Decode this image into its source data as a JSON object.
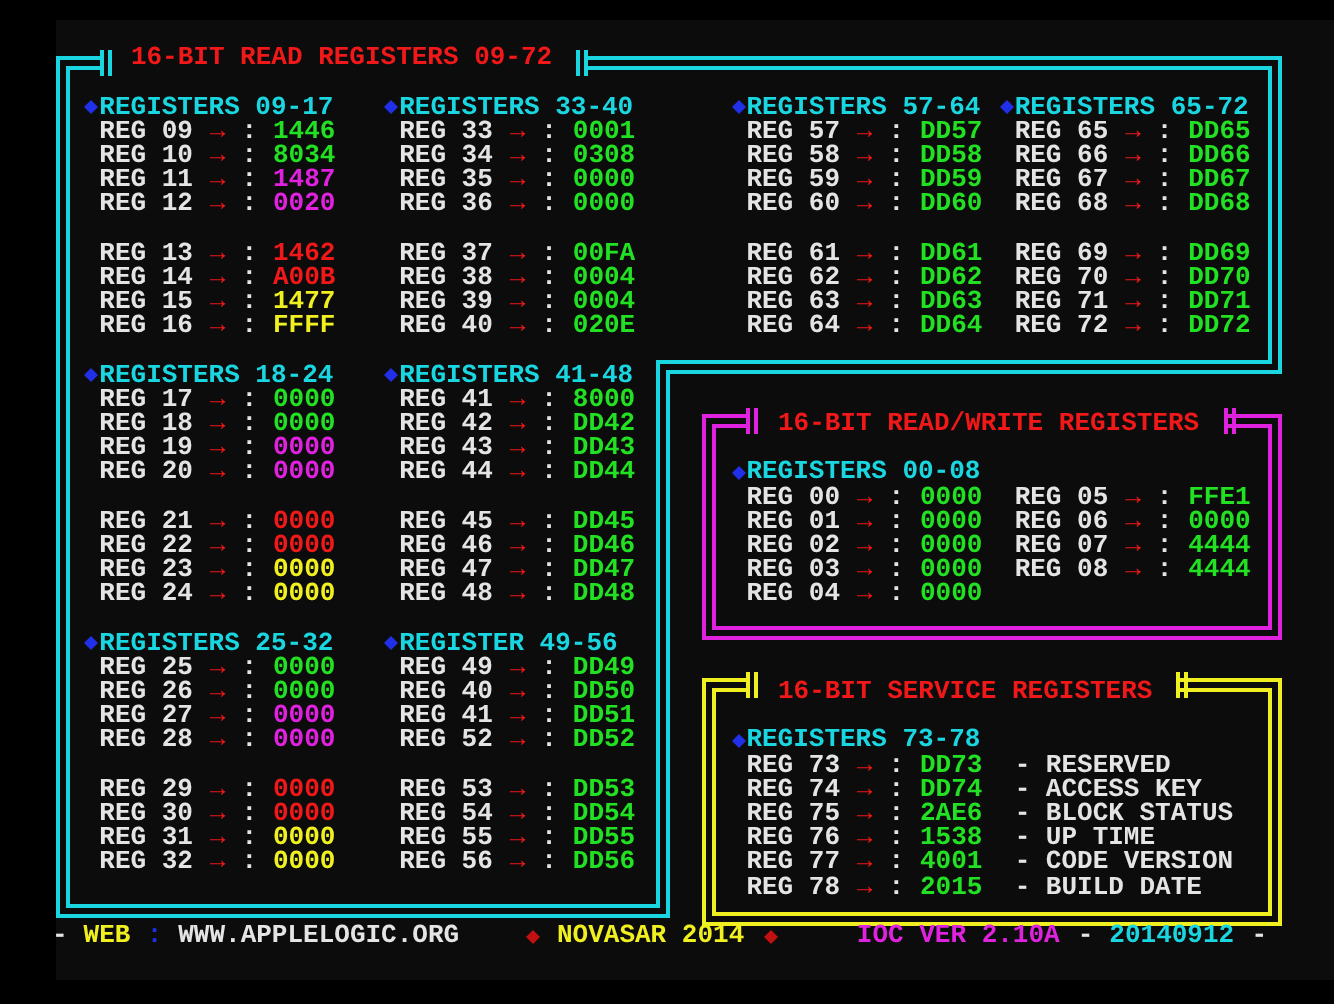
{
  "read_panel": {
    "title": "16-BIT READ REGISTERS 09-72",
    "groups": [
      {
        "heading": "REGISTERS 09-17",
        "registers": [
          {
            "label": "REG 09",
            "arrow": "→",
            "sep": ":",
            "value": "1446",
            "color": "#22e022"
          },
          {
            "label": "REG 10",
            "arrow": "→",
            "sep": ":",
            "value": "8034",
            "color": "#22e022"
          },
          {
            "label": "REG 11",
            "arrow": "→",
            "sep": ":",
            "value": "1487",
            "color": "#e022e0"
          },
          {
            "label": "REG 12",
            "arrow": "→",
            "sep": ":",
            "value": "0020",
            "color": "#e022e0"
          },
          {
            "label": "REG 13",
            "arrow": "→",
            "sep": ":",
            "value": "1462",
            "color": "#f01818"
          },
          {
            "label": "REG 14",
            "arrow": "→",
            "sep": ":",
            "value": "A00B",
            "color": "#f01818"
          },
          {
            "label": "REG 15",
            "arrow": "→",
            "sep": ":",
            "value": "1477",
            "color": "#f0f020"
          },
          {
            "label": "REG 16",
            "arrow": "→",
            "sep": ":",
            "value": "FFFF",
            "color": "#f0f020"
          }
        ]
      },
      {
        "heading": "REGISTERS 33-40",
        "registers": [
          {
            "label": "REG 33",
            "arrow": "→",
            "sep": ":",
            "value": "0001",
            "color": "#22e022"
          },
          {
            "label": "REG 34",
            "arrow": "→",
            "sep": ":",
            "value": "0308",
            "color": "#22e022"
          },
          {
            "label": "REG 35",
            "arrow": "→",
            "sep": ":",
            "value": "0000",
            "color": "#22e022"
          },
          {
            "label": "REG 36",
            "arrow": "→",
            "sep": ":",
            "value": "0000",
            "color": "#22e022"
          },
          {
            "label": "REG 37",
            "arrow": "→",
            "sep": ":",
            "value": "00FA",
            "color": "#22e022"
          },
          {
            "label": "REG 38",
            "arrow": "→",
            "sep": ":",
            "value": "0004",
            "color": "#22e022"
          },
          {
            "label": "REG 39",
            "arrow": "→",
            "sep": ":",
            "value": "0004",
            "color": "#22e022"
          },
          {
            "label": "REG 40",
            "arrow": "→",
            "sep": ":",
            "value": "020E",
            "color": "#22e022"
          }
        ]
      },
      {
        "heading": "REGISTERS 57-64",
        "registers": [
          {
            "label": "REG 57",
            "arrow": "→",
            "sep": ":",
            "value": "DD57",
            "color": "#22e022"
          },
          {
            "label": "REG 58",
            "arrow": "→",
            "sep": ":",
            "value": "DD58",
            "color": "#22e022"
          },
          {
            "label": "REG 59",
            "arrow": "→",
            "sep": ":",
            "value": "DD59",
            "color": "#22e022"
          },
          {
            "label": "REG 60",
            "arrow": "→",
            "sep": ":",
            "value": "DD60",
            "color": "#22e022"
          },
          {
            "label": "REG 61",
            "arrow": "→",
            "sep": ":",
            "value": "DD61",
            "color": "#22e022"
          },
          {
            "label": "REG 62",
            "arrow": "→",
            "sep": ":",
            "value": "DD62",
            "color": "#22e022"
          },
          {
            "label": "REG 63",
            "arrow": "→",
            "sep": ":",
            "value": "DD63",
            "color": "#22e022"
          },
          {
            "label": "REG 64",
            "arrow": "→",
            "sep": ":",
            "value": "DD64",
            "color": "#22e022"
          }
        ]
      },
      {
        "heading": "REGISTERS 65-72",
        "registers": [
          {
            "label": "REG 65",
            "arrow": "→",
            "sep": ":",
            "value": "DD65",
            "color": "#22e022"
          },
          {
            "label": "REG 66",
            "arrow": "→",
            "sep": ":",
            "value": "DD66",
            "color": "#22e022"
          },
          {
            "label": "REG 67",
            "arrow": "→",
            "sep": ":",
            "value": "DD67",
            "color": "#22e022"
          },
          {
            "label": "REG 68",
            "arrow": "→",
            "sep": ":",
            "value": "DD68",
            "color": "#22e022"
          },
          {
            "label": "REG 69",
            "arrow": "→",
            "sep": ":",
            "value": "DD69",
            "color": "#22e022"
          },
          {
            "label": "REG 70",
            "arrow": "→",
            "sep": ":",
            "value": "DD70",
            "color": "#22e022"
          },
          {
            "label": "REG 71",
            "arrow": "→",
            "sep": ":",
            "value": "DD71",
            "color": "#22e022"
          },
          {
            "label": "REG 72",
            "arrow": "→",
            "sep": ":",
            "value": "DD72",
            "color": "#22e022"
          }
        ]
      },
      {
        "heading": "REGISTERS 18-24",
        "registers": [
          {
            "label": "REG 17",
            "arrow": "→",
            "sep": ":",
            "value": "0000",
            "color": "#22e022"
          },
          {
            "label": "REG 18",
            "arrow": "→",
            "sep": ":",
            "value": "0000",
            "color": "#22e022"
          },
          {
            "label": "REG 19",
            "arrow": "→",
            "sep": ":",
            "value": "0000",
            "color": "#e022e0"
          },
          {
            "label": "REG 20",
            "arrow": "→",
            "sep": ":",
            "value": "0000",
            "color": "#e022e0"
          },
          {
            "label": "REG 21",
            "arrow": "→",
            "sep": ":",
            "value": "0000",
            "color": "#f01818"
          },
          {
            "label": "REG 22",
            "arrow": "→",
            "sep": ":",
            "value": "0000",
            "color": "#f01818"
          },
          {
            "label": "REG 23",
            "arrow": "→",
            "sep": ":",
            "value": "0000",
            "color": "#f0f020"
          },
          {
            "label": "REG 24",
            "arrow": "→",
            "sep": ":",
            "value": "0000",
            "color": "#f0f020"
          }
        ]
      },
      {
        "heading": "REGISTERS 41-48",
        "registers": [
          {
            "label": "REG 41",
            "arrow": "→",
            "sep": ":",
            "value": "8000",
            "color": "#22e022"
          },
          {
            "label": "REG 42",
            "arrow": "→",
            "sep": ":",
            "value": "DD42",
            "color": "#22e022"
          },
          {
            "label": "REG 43",
            "arrow": "→",
            "sep": ":",
            "value": "DD43",
            "color": "#22e022"
          },
          {
            "label": "REG 44",
            "arrow": "→",
            "sep": ":",
            "value": "DD44",
            "color": "#22e022"
          },
          {
            "label": "REG 45",
            "arrow": "→",
            "sep": ":",
            "value": "DD45",
            "color": "#22e022"
          },
          {
            "label": "REG 46",
            "arrow": "→",
            "sep": ":",
            "value": "DD46",
            "color": "#22e022"
          },
          {
            "label": "REG 47",
            "arrow": "→",
            "sep": ":",
            "value": "DD47",
            "color": "#22e022"
          },
          {
            "label": "REG 48",
            "arrow": "→",
            "sep": ":",
            "value": "DD48",
            "color": "#22e022"
          }
        ]
      },
      {
        "heading": "REGISTERS 25-32",
        "registers": [
          {
            "label": "REG 25",
            "arrow": "→",
            "sep": ":",
            "value": "0000",
            "color": "#22e022"
          },
          {
            "label": "REG 26",
            "arrow": "→",
            "sep": ":",
            "value": "0000",
            "color": "#22e022"
          },
          {
            "label": "REG 27",
            "arrow": "→",
            "sep": ":",
            "value": "0000",
            "color": "#e022e0"
          },
          {
            "label": "REG 28",
            "arrow": "→",
            "sep": ":",
            "value": "0000",
            "color": "#e022e0"
          },
          {
            "label": "REG 29",
            "arrow": "→",
            "sep": ":",
            "value": "0000",
            "color": "#f01818"
          },
          {
            "label": "REG 30",
            "arrow": "→",
            "sep": ":",
            "value": "0000",
            "color": "#f01818"
          },
          {
            "label": "REG 31",
            "arrow": "→",
            "sep": ":",
            "value": "0000",
            "color": "#f0f020"
          },
          {
            "label": "REG 32",
            "arrow": "→",
            "sep": ":",
            "value": "0000",
            "color": "#f0f020"
          }
        ]
      },
      {
        "heading": "REGISTER 49-56",
        "registers": [
          {
            "label": "REG 49",
            "arrow": "→",
            "sep": ":",
            "value": "DD49",
            "color": "#22e022"
          },
          {
            "label": "REG 40",
            "arrow": "→",
            "sep": ":",
            "value": "DD50",
            "color": "#22e022"
          },
          {
            "label": "REG 41",
            "arrow": "→",
            "sep": ":",
            "value": "DD51",
            "color": "#22e022"
          },
          {
            "label": "REG 52",
            "arrow": "→",
            "sep": ":",
            "value": "DD52",
            "color": "#22e022"
          },
          {
            "label": "REG 53",
            "arrow": "→",
            "sep": ":",
            "value": "DD53",
            "color": "#22e022"
          },
          {
            "label": "REG 54",
            "arrow": "→",
            "sep": ":",
            "value": "DD54",
            "color": "#22e022"
          },
          {
            "label": "REG 55",
            "arrow": "→",
            "sep": ":",
            "value": "DD55",
            "color": "#22e022"
          },
          {
            "label": "REG 56",
            "arrow": "→",
            "sep": ":",
            "value": "DD56",
            "color": "#22e022"
          }
        ]
      }
    ]
  },
  "rw_panel": {
    "title": "16-BIT READ/WRITE REGISTERS",
    "groups": [
      {
        "heading": "REGISTERS 00-08",
        "registers": [
          {
            "label": "REG 00",
            "arrow": "→",
            "sep": ":",
            "value": "0000",
            "color": "#22e022"
          },
          {
            "label": "REG 01",
            "arrow": "→",
            "sep": ":",
            "value": "0000",
            "color": "#22e022"
          },
          {
            "label": "REG 02",
            "arrow": "→",
            "sep": ":",
            "value": "0000",
            "color": "#22e022"
          },
          {
            "label": "REG 03",
            "arrow": "→",
            "sep": ":",
            "value": "0000",
            "color": "#22e022"
          },
          {
            "label": "REG 04",
            "arrow": "→",
            "sep": ":",
            "value": "0000",
            "color": "#22e022"
          },
          {
            "label": "REG 05",
            "arrow": "→",
            "sep": ":",
            "value": "FFE1",
            "color": "#22e022"
          },
          {
            "label": "REG 06",
            "arrow": "→",
            "sep": ":",
            "value": "0000",
            "color": "#22e022"
          },
          {
            "label": "REG 07",
            "arrow": "→",
            "sep": ":",
            "value": "4444",
            "color": "#22e022"
          },
          {
            "label": "REG 08",
            "arrow": "→",
            "sep": ":",
            "value": "4444",
            "color": "#22e022"
          }
        ]
      }
    ]
  },
  "service_panel": {
    "title": "16-BIT SERVICE REGISTERS",
    "groups": [
      {
        "heading": "REGISTERS 73-78",
        "registers": [
          {
            "label": "REG 73",
            "arrow": "→",
            "sep": ":",
            "value": "DD73",
            "color": "#22e022",
            "description": "- RESERVED"
          },
          {
            "label": "REG 74",
            "arrow": "→",
            "sep": ":",
            "value": "DD74",
            "color": "#22e022",
            "description": "- ACCESS KEY"
          },
          {
            "label": "REG 75",
            "arrow": "→",
            "sep": ":",
            "value": "2AE6",
            "color": "#22e022",
            "description": "- BLOCK STATUS"
          },
          {
            "label": "REG 76",
            "arrow": "→",
            "sep": ":",
            "value": "1538",
            "color": "#22e022",
            "description": "- UP TIME"
          },
          {
            "label": "REG 77",
            "arrow": "→",
            "sep": ":",
            "value": "4001",
            "color": "#22e022",
            "description": "- CODE VERSION"
          },
          {
            "label": "REG 78",
            "arrow": "→",
            "sep": ":",
            "value": "2015",
            "color": "#22e022",
            "description": "- BUILD DATE"
          }
        ]
      }
    ]
  },
  "footer": {
    "dash_left": "-",
    "web_label": "WEB",
    "colon": ":",
    "url": "WWW.APPLELOGIC.ORG",
    "product": "NOVASAR 2014",
    "version": "IOC VER 2.10A",
    "dash_mid": "-",
    "date": "20140912",
    "dash_right": "-"
  }
}
